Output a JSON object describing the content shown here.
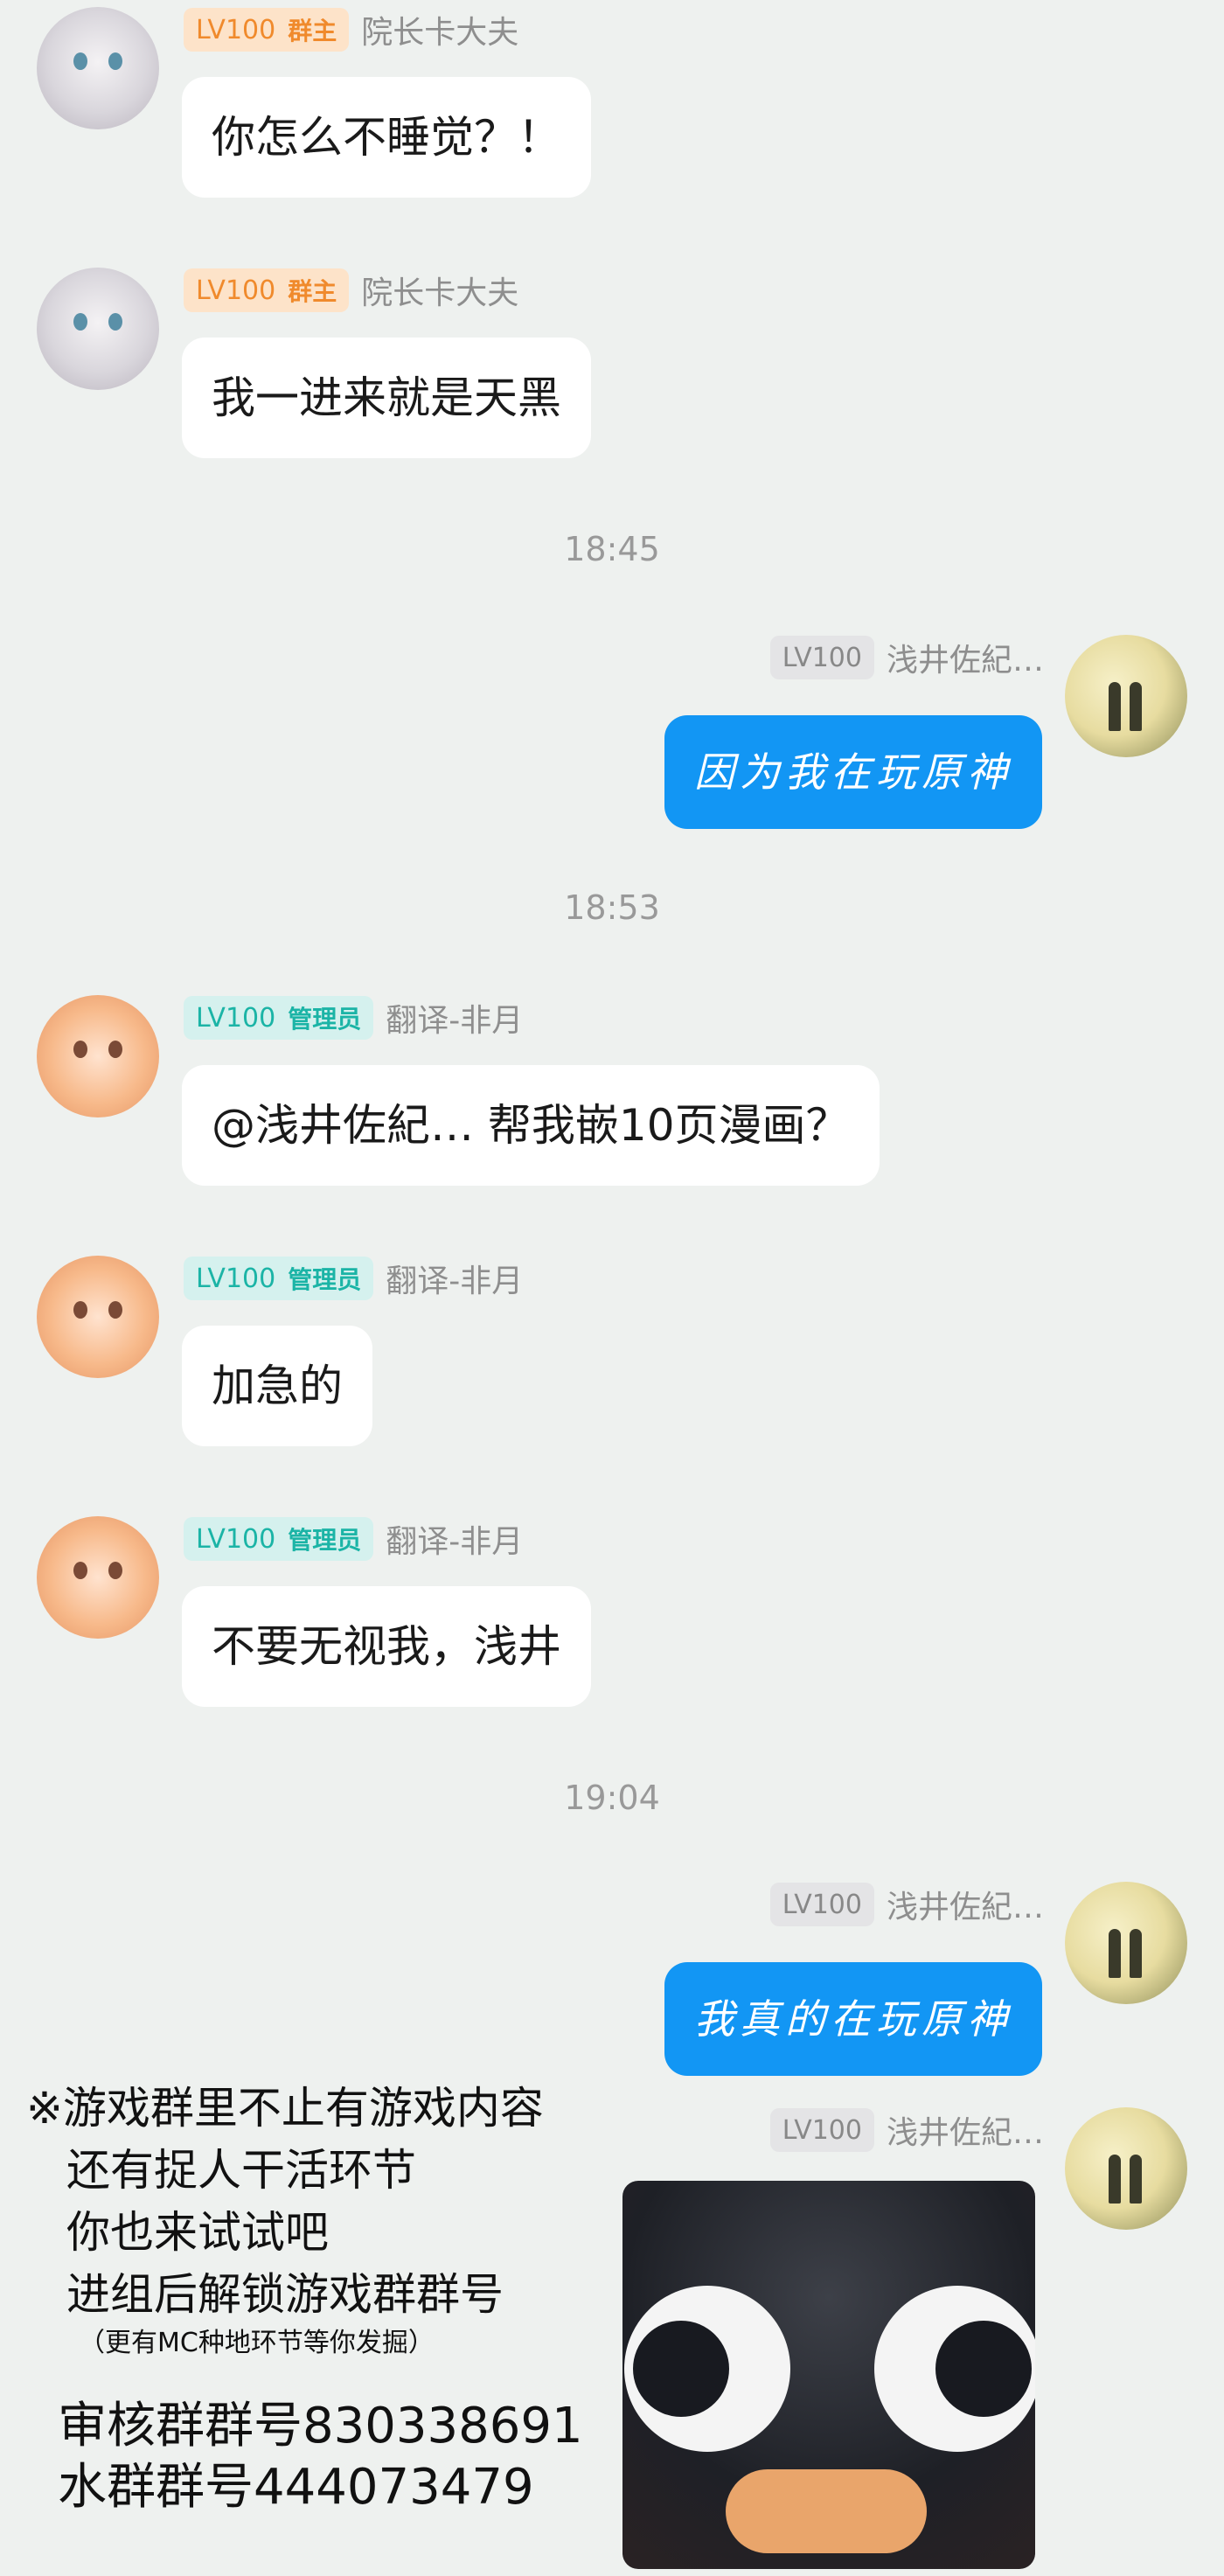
{
  "messages": [
    {
      "level": "LV100",
      "role": "群主",
      "nick": "院长卡大夫",
      "text": "你怎么不睡觉？！"
    },
    {
      "level": "LV100",
      "role": "群主",
      "nick": "院长卡大夫",
      "text": "我一进来就是天黑"
    },
    {
      "level": "LV100",
      "nick": "浅井佐紀…",
      "text": "因为我在玩原神"
    },
    {
      "level": "LV100",
      "role": "管理员",
      "nick": "翻译-非月",
      "text": "@浅井佐紀…  帮我嵌10页漫画？"
    },
    {
      "level": "LV100",
      "role": "管理员",
      "nick": "翻译-非月",
      "text": "加急的"
    },
    {
      "level": "LV100",
      "role": "管理员",
      "nick": "翻译-非月",
      "text": "不要无视我，浅井"
    },
    {
      "level": "LV100",
      "nick": "浅井佐紀…",
      "text": "我真的在玩原神"
    },
    {
      "level": "LV100",
      "nick": "浅井佐紀…"
    }
  ],
  "times": [
    "18:45",
    "18:53",
    "19:04"
  ],
  "overlay": {
    "line1": "※游戏群里不止有游戏内容",
    "line2": "还有捉人干活环节",
    "line3": "你也来试试吧",
    "line4": "进组后解锁游戏群群号",
    "note": "（更有MC种地环节等你发掘）",
    "review_group": "审核群群号830338691",
    "water_group": "水群群号444073479"
  },
  "colors": {
    "background": "#eef1ef",
    "outgoing_bubble": "#1296f4",
    "owner_badge": "#f08a2c",
    "admin_badge": "#1bb4a6"
  }
}
